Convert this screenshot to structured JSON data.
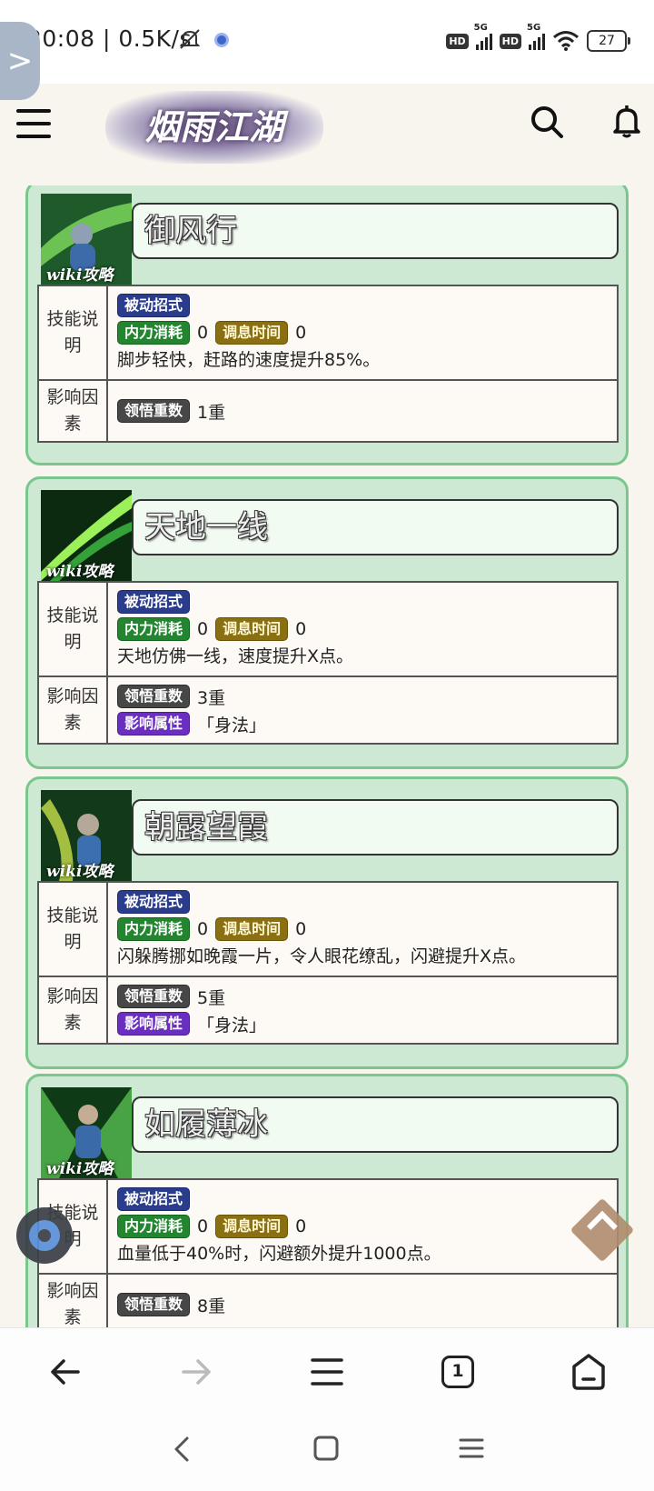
{
  "status": {
    "time_speed": "20:08 | 0.5K/s",
    "net1": "5G",
    "net2": "5G",
    "hd1": "HD",
    "hd2": "HD",
    "battery": "27"
  },
  "sidebar_toggle": ">",
  "header": {
    "logo_text": "烟雨江湖"
  },
  "skill_icon_watermark": "wiki攻略",
  "labels": {
    "desc_label": "技能说明",
    "factor_label": "影响因素",
    "passive": "被动招式",
    "mp_cost": "内力消耗",
    "cooldown": "调息时间",
    "comprehension": "领悟重数",
    "attribute": "影响属性"
  },
  "skills": [
    {
      "name": "御风行",
      "mp_cost_value": "0",
      "cooldown_value": "0",
      "description": "脚步轻快，赶路的速度提升85%。",
      "comprehension_value": "1重",
      "attribute_value": ""
    },
    {
      "name": "天地一线",
      "mp_cost_value": "0",
      "cooldown_value": "0",
      "description": "天地仿佛一线，速度提升X点。",
      "comprehension_value": "3重",
      "attribute_value": "「身法」"
    },
    {
      "name": "朝露望霞",
      "mp_cost_value": "0",
      "cooldown_value": "0",
      "description": "闪躲腾挪如晚霞一片，令人眼花缭乱，闪避提升X点。",
      "comprehension_value": "5重",
      "attribute_value": "「身法」"
    },
    {
      "name": "如履薄冰",
      "mp_cost_value": "0",
      "cooldown_value": "0",
      "description": "血量低于40%时，闪避额外提升1000点。",
      "comprehension_value": "8重",
      "attribute_value": ""
    }
  ],
  "browser": {
    "tab_count": "1"
  },
  "colors": {
    "card_bg": "#cde8d3",
    "card_border": "#7bc68c",
    "tag_navy": "#2a3c8c",
    "tag_green": "#23852f",
    "tag_olive": "#8a7011",
    "tag_gray": "#474747",
    "tag_purple": "#6a2fc0"
  }
}
